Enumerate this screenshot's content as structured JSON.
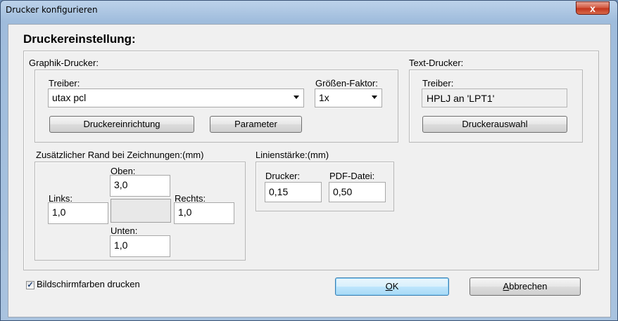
{
  "window": {
    "title": "Drucker konfigurieren",
    "close_glyph": "x"
  },
  "heading": "Druckereinstellung:",
  "graphic": {
    "group_label": "Graphik-Drucker:",
    "driver_label": "Treiber:",
    "driver_value": "utax pcl",
    "size_label": "Größen-Faktor:",
    "size_value": "1x",
    "setup_button": "Druckereinrichtung",
    "param_button": "Parameter"
  },
  "text_printer": {
    "group_label": "Text-Drucker:",
    "driver_label": "Treiber:",
    "driver_value": "HPLJ an 'LPT1'",
    "select_button": "Druckerauswahl"
  },
  "margins": {
    "group_label": "Zusätzlicher Rand bei Zeichnungen:(mm)",
    "top_label": "Oben:",
    "top_value": "3,0",
    "left_label": "Links:",
    "left_value": "1,0",
    "right_label": "Rechts:",
    "right_value": "1,0",
    "bottom_label": "Unten:",
    "bottom_value": "1,0"
  },
  "line": {
    "group_label": "Linienstärke:(mm)",
    "printer_label": "Drucker:",
    "printer_value": "0,15",
    "pdf_label": "PDF-Datei:",
    "pdf_value": "0,50"
  },
  "screen_colors": {
    "label": "Bildschirmfarben drucken",
    "checked": true,
    "mark": "✓"
  },
  "buttons": {
    "ok_mnemonic": "O",
    "ok_rest": "K",
    "cancel_mnemonic": "A",
    "cancel_rest": "bbrechen"
  }
}
